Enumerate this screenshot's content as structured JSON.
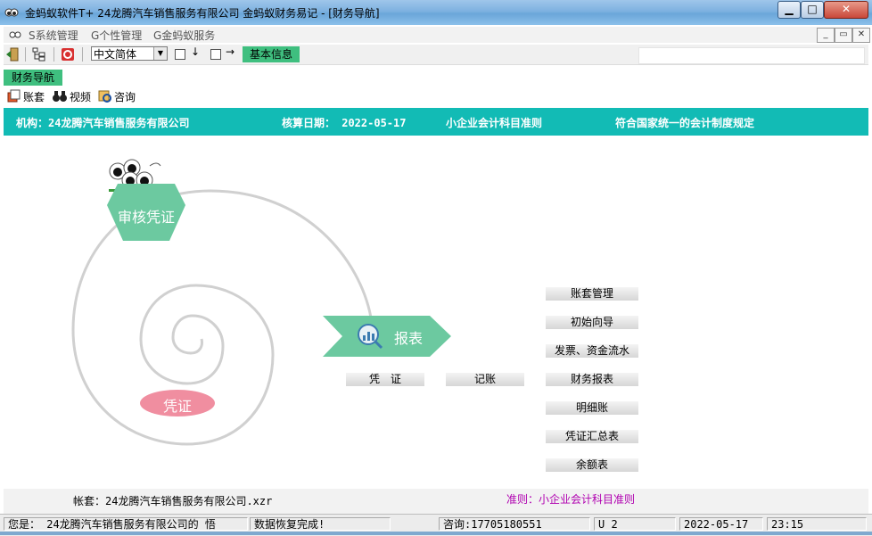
{
  "window": {
    "title": "金蚂蚁软件T+ 24龙腾汽车销售服务有限公司 金蚂蚁财务易记 - [财务导航]",
    "min_glyph": "▁",
    "max_glyph": "□",
    "close_glyph": "✕"
  },
  "menu": {
    "items": [
      "S系统管理",
      "G个性管理",
      "G金蚂蚁服务"
    ],
    "mdi_min": "_",
    "mdi_restore": "▭",
    "mdi_close": "✕"
  },
  "toolbar": {
    "language": "中文简体",
    "down_arrow": "↓",
    "right_arrow": "→",
    "basic_info": "基本信息"
  },
  "nav_tab": "财务导航",
  "sub_toolbar": {
    "ledger": "账套",
    "video": "视频",
    "consult": "咨询"
  },
  "info_band": {
    "org": "机构：24龙腾汽车销售服务有限公司",
    "date": "核算日期： 2022-05-17",
    "standard": "小企业会计科目准则",
    "compliance": "符合国家统一的会计制度规定"
  },
  "flow": {
    "audit": "审核凭证",
    "report": "报表",
    "voucher": "凭证",
    "voucher_btn": "凭　证",
    "bookkeep_btn": "记账"
  },
  "side_menu": [
    "账套管理",
    "初始向导",
    "发票、资金流水",
    "财务报表",
    "明细账",
    "凭证汇总表",
    "余额表"
  ],
  "footer": {
    "account_file": "帐套：24龙腾汽车销售服务有限公司.xzr",
    "standard": "准则：小企业会计科目准则"
  },
  "status": {
    "user": "您是： 24龙腾汽车销售服务有限公司的  悟",
    "message": "数据恢复完成!",
    "consult": "咨询:17705180551",
    "u": "U 2",
    "date": "2022-05-17",
    "time": "23:15"
  },
  "colors": {
    "green_accent": "#3fbf7f",
    "teal_band": "#12bbb5",
    "audit_shape": "#6cc9a0",
    "report_shape": "#6cc9a0",
    "voucher_shape": "#f08ea0",
    "standard_text": "#b000b0"
  }
}
